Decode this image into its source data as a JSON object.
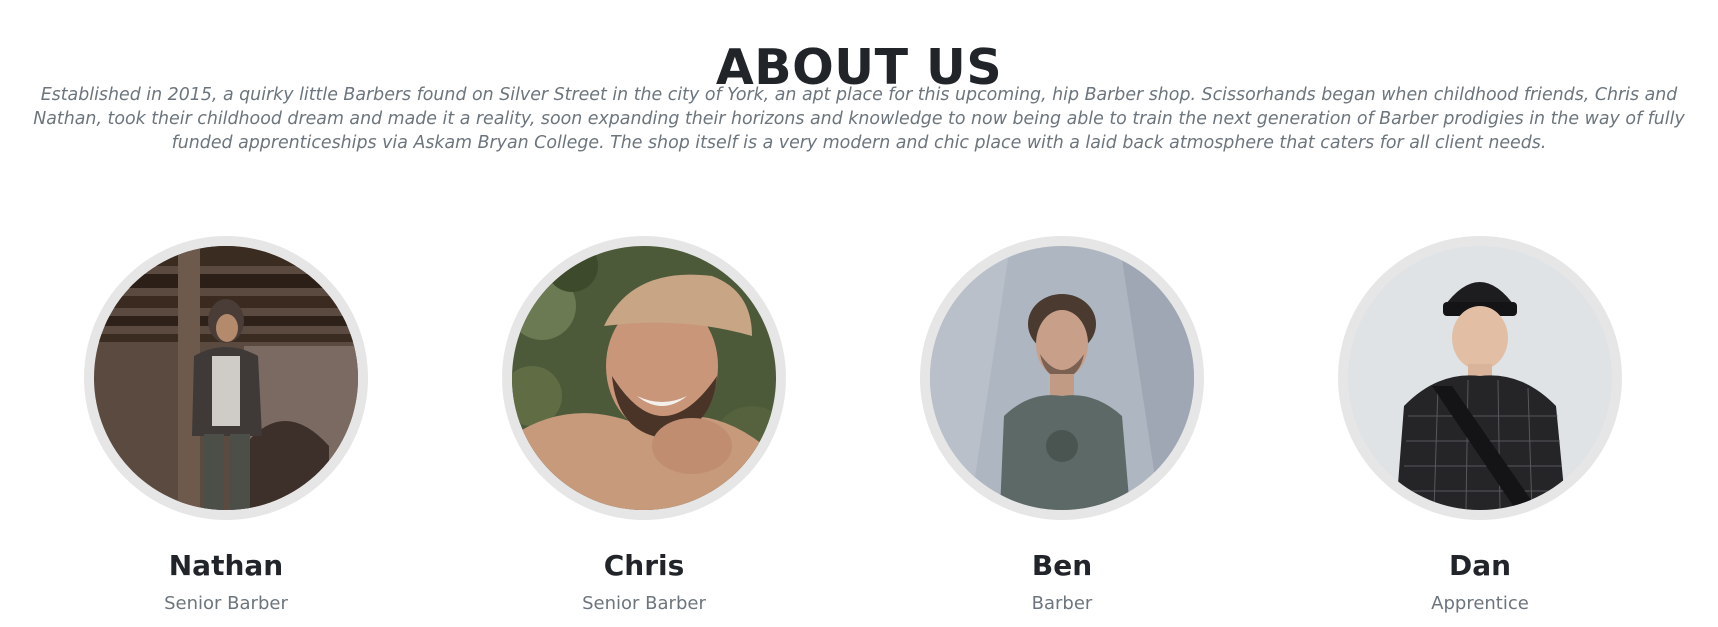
{
  "about": {
    "title": "ABOUT US",
    "intro": "Established in 2015, a quirky little Barbers found on Silver Street in the city of York, an apt place for this upcoming, hip Barber shop. Scissorhands began when childhood friends, Chris and Nathan, took their childhood dream and made it a reality, soon expanding their horizons and knowledge to now being able to train the next generation of Barber prodigies in the way of fully funded apprenticeships via Askam Bryan College. The shop itself is a very modern and chic place with a laid back atmosphere that caters for all client needs."
  },
  "team": [
    {
      "name": "Nathan",
      "role": "Senior Barber",
      "photo_icon": "portrait-photo"
    },
    {
      "name": "Chris",
      "role": "Senior Barber",
      "photo_icon": "portrait-photo"
    },
    {
      "name": "Ben",
      "role": "Barber",
      "photo_icon": "portrait-photo"
    },
    {
      "name": "Dan",
      "role": "Apprentice",
      "photo_icon": "portrait-photo"
    }
  ],
  "colors": {
    "heading": "#212529",
    "muted": "#6c757d",
    "photo_ring": "#e6e6e6"
  }
}
